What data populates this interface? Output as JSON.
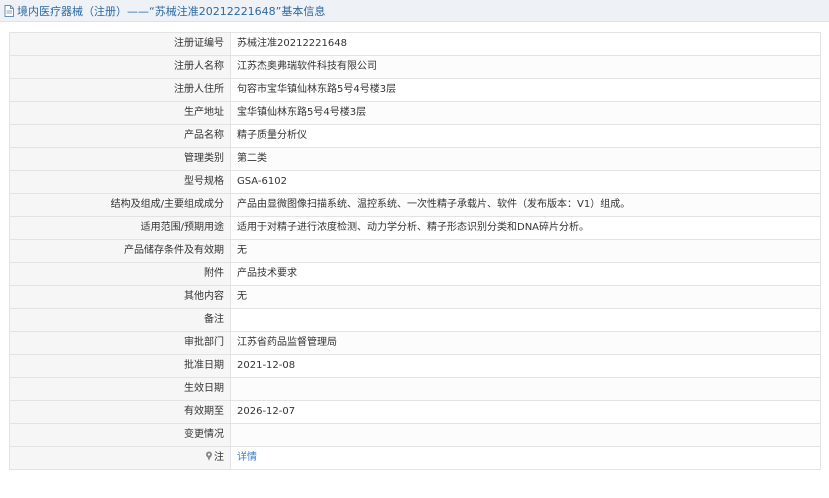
{
  "header": {
    "title": "境内医疗器械（注册）——“苏械注准20212221648”基本信息"
  },
  "rows": [
    {
      "label": "注册证编号",
      "value": "苏械注准20212221648"
    },
    {
      "label": "注册人名称",
      "value": "江苏杰奥弗瑞软件科技有限公司"
    },
    {
      "label": "注册人住所",
      "value": "句容市宝华镇仙林东路5号4号楼3层"
    },
    {
      "label": "生产地址",
      "value": "宝华镇仙林东路5号4号楼3层"
    },
    {
      "label": "产品名称",
      "value": "精子质量分析仪"
    },
    {
      "label": "管理类别",
      "value": "第二类"
    },
    {
      "label": "型号规格",
      "value": "GSA-6102"
    },
    {
      "label": "结构及组成/主要组成成分",
      "value": "产品由显微图像扫描系统、温控系统、一次性精子承载片、软件（发布版本：V1）组成。"
    },
    {
      "label": "适用范围/预期用途",
      "value": "适用于对精子进行浓度检测、动力学分析、精子形态识别分类和DNA碎片分析。"
    },
    {
      "label": "产品储存条件及有效期",
      "value": "无"
    },
    {
      "label": "附件",
      "value": "产品技术要求"
    },
    {
      "label": "其他内容",
      "value": "无"
    },
    {
      "label": "备注",
      "value": ""
    },
    {
      "label": "审批部门",
      "value": "江苏省药品监督管理局"
    },
    {
      "label": "批准日期",
      "value": "2021-12-08"
    },
    {
      "label": "生效日期",
      "value": ""
    },
    {
      "label": "有效期至",
      "value": "2026-12-07"
    },
    {
      "label": "变更情况",
      "value": ""
    }
  ],
  "note_row": {
    "label": "注",
    "icon": "pin-icon",
    "link_label": "详情"
  },
  "colors": {
    "title_text": "#2c6aa0",
    "link": "#3a7bc8",
    "label_bg": "#f6f6f6",
    "border": "#e3e3e3"
  }
}
